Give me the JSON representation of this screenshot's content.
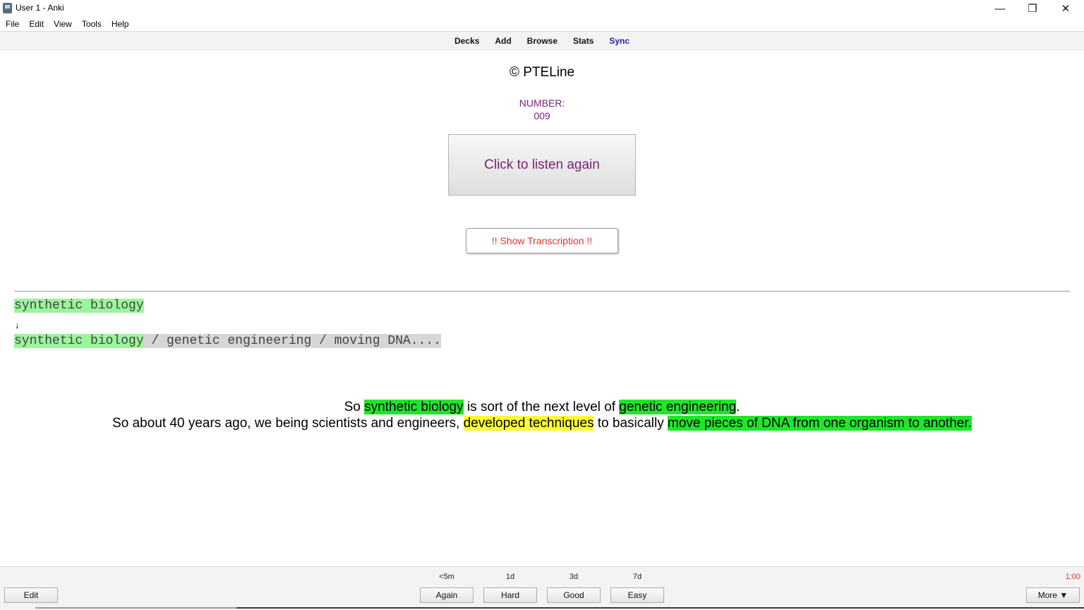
{
  "window": {
    "title": "User 1 - Anki",
    "minimize": "—",
    "restore": "❐",
    "close": "✕"
  },
  "menu": [
    "File",
    "Edit",
    "View",
    "Tools",
    "Help"
  ],
  "toolbar": {
    "decks": "Decks",
    "add": "Add",
    "browse": "Browse",
    "stats": "Stats",
    "sync": "Sync"
  },
  "card": {
    "copyright": "© PTELine",
    "number_label": "NUMBER:",
    "number_value": "009",
    "listen_label": "Click to listen again",
    "show_label": "!! Show Transcription !!",
    "keyword": "synthetic biology",
    "arrow": "↓",
    "keyword_line_a": "synthetic biology",
    "keyword_line_b": " / genetic engineering / moving DNA....",
    "transcript": {
      "l1_a": "So ",
      "l1_b": "synthetic biology",
      "l1_c": " is sort of the next level of ",
      "l1_d": "genetic engineering",
      "l1_e": ".",
      "l2_a": "So about 40 years ago, we being scientists and engineers, ",
      "l2_b": "developed techniques",
      "l2_c": " to basically ",
      "l2_d": "move pieces of DNA from one organism to another."
    }
  },
  "bottom": {
    "edit": "Edit",
    "intervals": {
      "again": "<5m",
      "hard": "1d",
      "good": "3d",
      "easy": "7d"
    },
    "again": "Again",
    "hard": "Hard",
    "good": "Good",
    "easy": "Easy",
    "timer": "1:00",
    "more": "More ▼"
  }
}
